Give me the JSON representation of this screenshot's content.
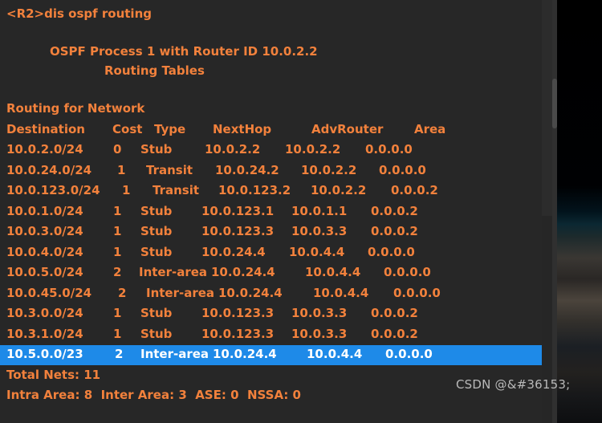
{
  "terminal": {
    "prompt_line": "<R2>dis ospf routing",
    "process_header": "OSPF Process 1 with Router ID 10.0.2.2",
    "tables_header": "Routing Tables",
    "section_label": "Routing for Network",
    "text_color": "#f2813c",
    "background_color": "#272727",
    "selection_color": "#1e8ae8",
    "selection_text_color": "#ffffff",
    "columns": [
      "Destination",
      "Cost",
      "Type",
      "NextHop",
      "AdvRouter",
      "Area"
    ],
    "rows": [
      {
        "destination": "10.0.2.0/24",
        "cost": "0",
        "type": "Stub",
        "nexthop": "10.0.2.2",
        "advrouter": "10.0.2.2",
        "area": "0.0.0.0",
        "selected": false,
        "x": {
          "destination": 8,
          "cost": 141,
          "type": "175",
          "nexthop": 255,
          "advrouter": 355,
          "area": 455
        }
      },
      {
        "destination": "10.0.24.0/24",
        "cost": "1",
        "type": "Transit",
        "nexthop": "10.0.24.2",
        "advrouter": "10.0.2.2",
        "area": "0.0.0.0",
        "selected": false,
        "x": {
          "destination": 8,
          "cost": 146,
          "type": "182",
          "nexthop": 268,
          "advrouter": 375,
          "area": 472
        }
      },
      {
        "destination": "10.0.123.0/24",
        "cost": "1",
        "type": "Transit",
        "nexthop": "10.0.123.2",
        "advrouter": "10.0.2.2",
        "area": "0.0.0.2",
        "selected": false,
        "x": {
          "destination": 8,
          "cost": 152,
          "type": "190",
          "nexthop": 272,
          "advrouter": 387,
          "area": 487
        }
      },
      {
        "destination": "10.0.1.0/24",
        "cost": "1",
        "type": "Stub",
        "nexthop": "10.0.123.1",
        "advrouter": "10.0.1.1",
        "area": "0.0.0.2",
        "selected": false,
        "x": {
          "destination": 8,
          "cost": 141,
          "type": "175",
          "nexthop": 251,
          "advrouter": 363,
          "area": 462
        }
      },
      {
        "destination": "10.0.3.0/24",
        "cost": "1",
        "type": "Stub",
        "nexthop": "10.0.123.3",
        "advrouter": "10.0.3.3",
        "area": "0.0.0.2",
        "selected": false,
        "x": {
          "destination": 8,
          "cost": 141,
          "type": "175",
          "nexthop": 251,
          "advrouter": 363,
          "area": 462
        }
      },
      {
        "destination": "10.0.4.0/24",
        "cost": "1",
        "type": "Stub",
        "nexthop": "10.0.24.4",
        "advrouter": "10.0.4.4",
        "area": "0.0.0.0",
        "selected": false,
        "x": {
          "destination": 8,
          "cost": 141,
          "type": "175",
          "nexthop": 251,
          "advrouter": 360,
          "area": 458
        }
      },
      {
        "destination": "10.0.5.0/24",
        "cost": "2",
        "type": "Inter-area",
        "nexthop": "10.0.24.4",
        "advrouter": "10.0.4.4",
        "area": "0.0.0.0",
        "selected": false,
        "x": {
          "destination": 8,
          "cost": 141,
          "type": "173",
          "nexthop": 263,
          "advrouter": 380,
          "area": 478
        }
      },
      {
        "destination": "10.0.45.0/24",
        "cost": "2",
        "type": "Inter-area",
        "nexthop": "10.0.24.4",
        "advrouter": "10.0.4.4",
        "area": "0.0.0.0",
        "selected": false,
        "x": {
          "destination": 8,
          "cost": 147,
          "type": "182",
          "nexthop": 272,
          "advrouter": 390,
          "area": 490
        }
      },
      {
        "destination": "10.3.0.0/24",
        "cost": "1",
        "type": "Stub",
        "nexthop": "10.0.123.3",
        "advrouter": "10.0.3.3",
        "area": "0.0.0.2",
        "selected": false,
        "x": {
          "destination": 8,
          "cost": 141,
          "type": "175",
          "nexthop": 251,
          "advrouter": 363,
          "area": 462
        }
      },
      {
        "destination": "10.3.1.0/24",
        "cost": "1",
        "type": "Stub",
        "nexthop": "10.0.123.3",
        "advrouter": "10.0.3.3",
        "area": "0.0.0.2",
        "selected": false,
        "x": {
          "destination": 8,
          "cost": 141,
          "type": "175",
          "nexthop": 251,
          "advrouter": 363,
          "area": 462
        }
      },
      {
        "destination": "10.5.0.0/23",
        "cost": "2",
        "type": "Inter-area",
        "nexthop": "10.0.24.4",
        "advrouter": "10.0.4.4",
        "area": "0.0.0.0",
        "selected": true,
        "x": {
          "destination": 8,
          "cost": 143,
          "type": "175",
          "nexthop": 265,
          "advrouter": 382,
          "area": 480
        }
      }
    ],
    "summary": {
      "total_nets": "Total Nets: 11",
      "area_counts": "Intra Area: 8  Inter Area: 3  ASE: 0  NSSA: 0"
    },
    "header_positions": {
      "destination": 8,
      "cost": 140,
      "type": "192",
      "nexthop": 265,
      "advrouter": 388,
      "area": 516
    }
  },
  "watermark": {
    "text": "CSDN @&#36153;"
  }
}
